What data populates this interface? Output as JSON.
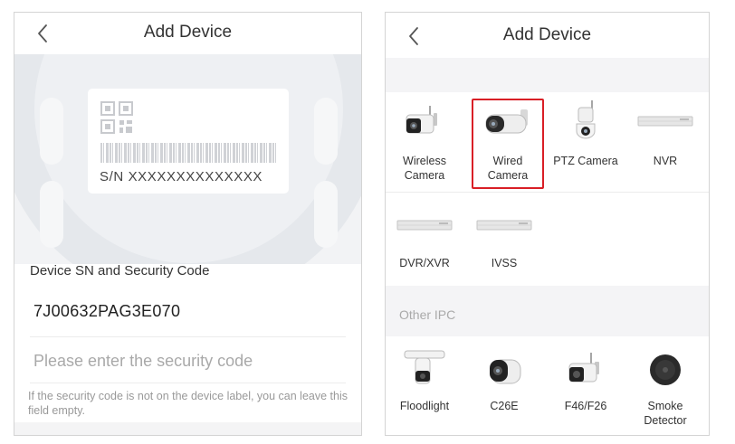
{
  "left": {
    "header": {
      "title": "Add Device"
    },
    "label_preview": {
      "sn_text": "S/N   XXXXXXXXXXXXXX"
    },
    "section_label": "Device SN and Security Code",
    "sn_value": "7J00632PAG3E070",
    "security_input": {
      "value": "",
      "placeholder": "Please enter the security code"
    },
    "hint": "If the security code is not on the device label, you can leave this field empty."
  },
  "right": {
    "header": {
      "title": "Add Device"
    },
    "device_types": [
      {
        "name_line1": "Wireless",
        "name_line2": "Camera",
        "icon": "wireless-camera-icon",
        "selected": false
      },
      {
        "name_line1": "Wired",
        "name_line2": "Camera",
        "icon": "wired-camera-icon",
        "selected": true
      },
      {
        "name_line1": "PTZ Camera",
        "name_line2": "",
        "icon": "ptz-camera-icon",
        "selected": false
      },
      {
        "name_line1": "NVR",
        "name_line2": "",
        "icon": "nvr-icon",
        "selected": false
      },
      {
        "name_line1": "DVR/XVR",
        "name_line2": "",
        "icon": "dvr-icon",
        "selected": false
      },
      {
        "name_line1": "IVSS",
        "name_line2": "",
        "icon": "ivss-icon",
        "selected": false
      }
    ],
    "other_section_label": "Other IPC",
    "other_ipc": [
      {
        "name_line1": "Floodlight",
        "name_line2": "",
        "icon": "floodlight-camera-icon"
      },
      {
        "name_line1": "C26E",
        "name_line2": "",
        "icon": "c26e-camera-icon"
      },
      {
        "name_line1": "F46/F26",
        "name_line2": "",
        "icon": "f46-camera-icon"
      },
      {
        "name_line1": "Smoke",
        "name_line2": "Detector",
        "icon": "smoke-detector-icon"
      }
    ]
  },
  "colors": {
    "selected_border": "#d91f26",
    "section_bg": "#f4f4f6",
    "placeholder": "#a9a9a9"
  }
}
